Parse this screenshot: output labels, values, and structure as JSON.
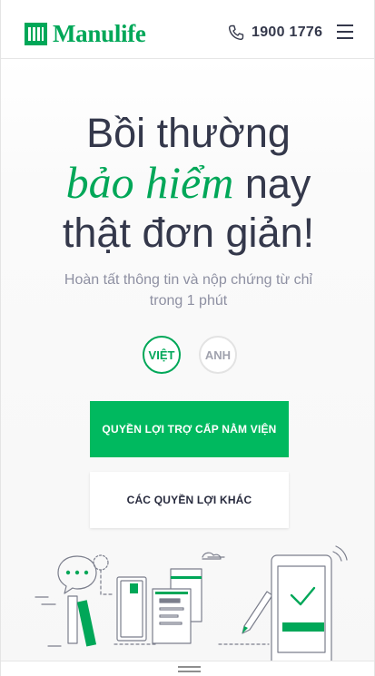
{
  "header": {
    "brand": "Manulife",
    "phone": "1900 1776"
  },
  "hero": {
    "line1": "Bồi thường",
    "accent": "bảo hiểm",
    "line2_rest": " nay",
    "line3": "thật đơn giản!",
    "subtitle": "Hoàn tất thông tin và nộp chứng từ chỉ trong 1 phút"
  },
  "language": {
    "vi": "VIỆT",
    "en": "ANH",
    "selected": "vi"
  },
  "buttons": {
    "primary": "QUYỀN LỢI TRỢ CẤP NẰM VIỆN",
    "secondary": "CÁC QUYỀN LỢI KHÁC"
  },
  "colors": {
    "brand_green": "#00a758",
    "button_green": "#00b95f",
    "text_dark": "#34384b",
    "text_muted": "#8e90a2"
  },
  "icons": {
    "logo": "manulife-logo-icon",
    "phone": "phone-icon",
    "menu": "hamburger-menu-icon"
  }
}
